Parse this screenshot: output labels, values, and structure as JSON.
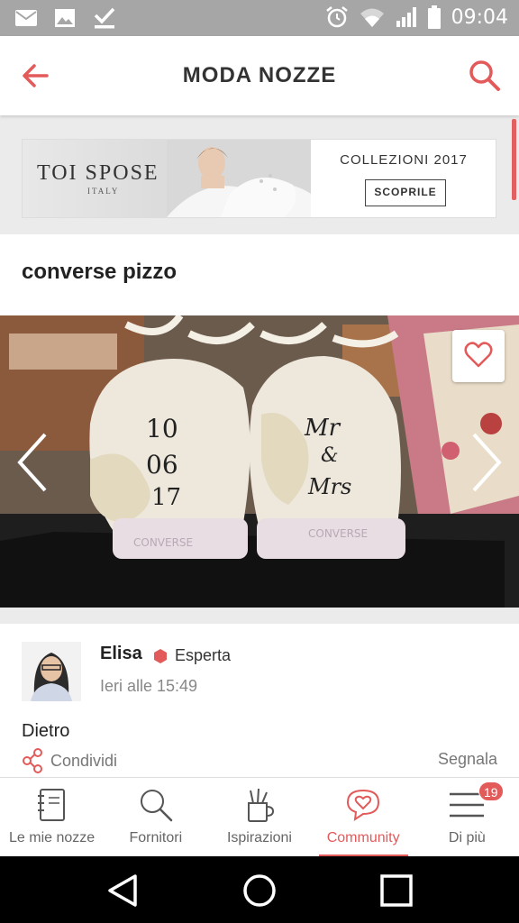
{
  "status_bar": {
    "time": "09:04"
  },
  "header": {
    "title": "MODA NOZZE"
  },
  "banner": {
    "brand": "TOI SPOSE",
    "brand_sub": "ITALY",
    "collection": "COLLEZIONI 2017",
    "cta": "SCOPRILE"
  },
  "post": {
    "title": "converse pizzo",
    "photo": {
      "date_text": [
        "10",
        "06",
        "17"
      ],
      "names_text": [
        "Mr",
        "&",
        "Mrs"
      ],
      "brand_text": "CONVERSE"
    }
  },
  "author": {
    "name": "Elisa",
    "badge": "Esperta",
    "time": "Ieri alle 15:49",
    "body": "Dietro",
    "share": "Condividi",
    "report": "Segnala"
  },
  "bottom_nav": {
    "tabs": [
      {
        "label": "Le mie nozze",
        "icon": "notebook-icon"
      },
      {
        "label": "Fornitori",
        "icon": "search-icon"
      },
      {
        "label": "Ispirazioni",
        "icon": "brushes-cup-icon"
      },
      {
        "label": "Community",
        "icon": "chat-heart-icon",
        "active": true
      },
      {
        "label": "Di più",
        "icon": "menu-icon",
        "badge": "19"
      }
    ]
  },
  "colors": {
    "accent": "#e35a5a",
    "status_bar": "#a6a6a6"
  }
}
